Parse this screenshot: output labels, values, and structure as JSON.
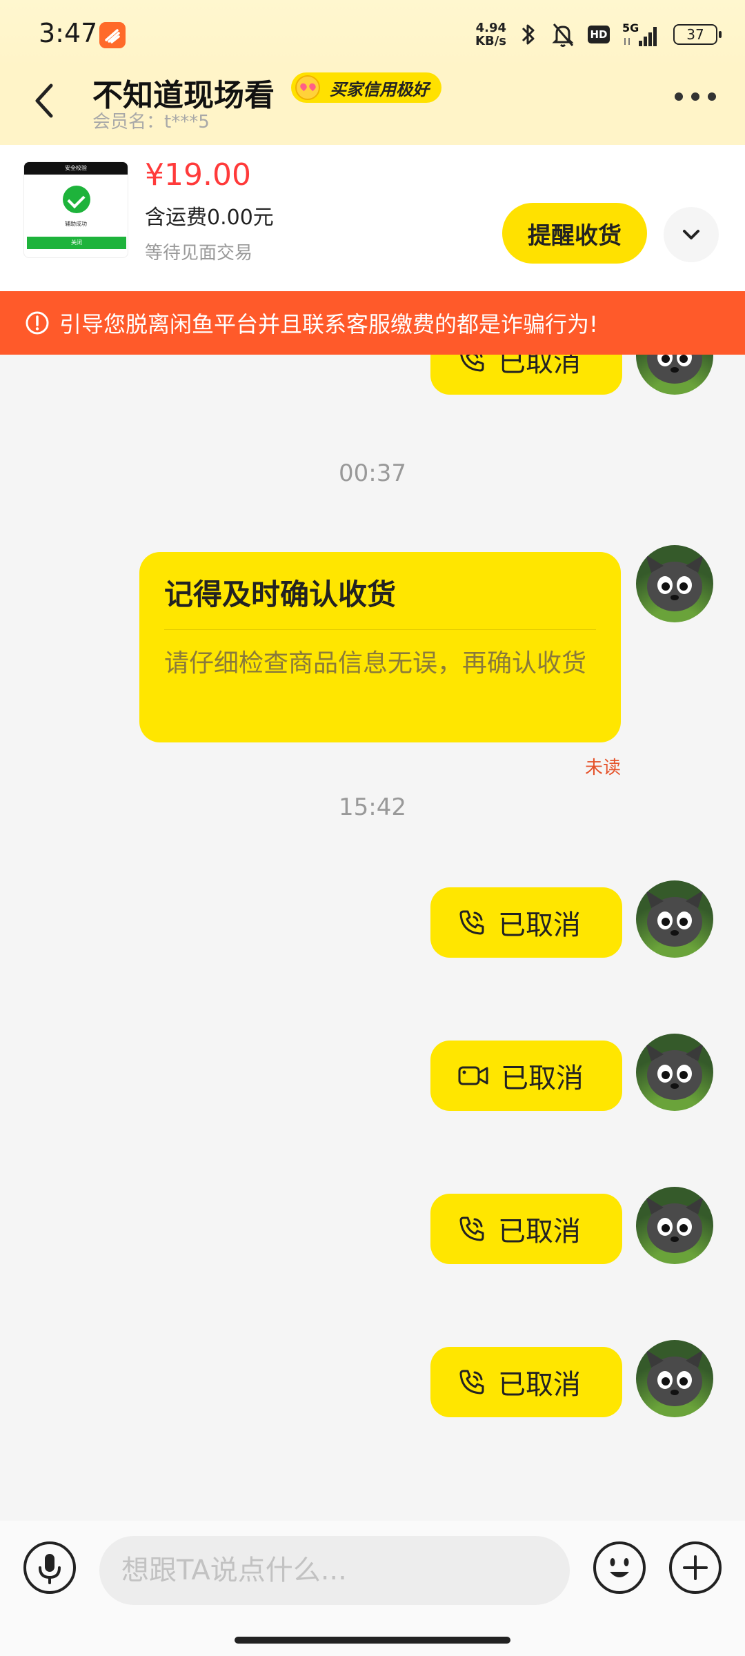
{
  "status_bar": {
    "time": "3:47",
    "net_speed_value": "4.94",
    "net_speed_unit": "KB/s",
    "hd": "HD",
    "signal_label": "5G",
    "battery": "37"
  },
  "header": {
    "title": "不知道现场看",
    "badge": "买家信用极好",
    "member_name": "会员名：t***5"
  },
  "product": {
    "thumb_top": "安全校验",
    "thumb_text": "辅助成功",
    "thumb_button": "关闭",
    "price": "¥19.00",
    "shipping": "含运费0.00元",
    "status": "等待见面交易",
    "remind_label": "提醒收货"
  },
  "warning": {
    "text": "引导您脱离闲鱼平台并且联系客服缴费的都是诈骗行为!"
  },
  "messages": {
    "partial_call_label": "已取消",
    "time_1": "00:37",
    "card_title": "记得及时确认收货",
    "card_body": "请仔细检查商品信息无误，再确认收货",
    "unread": "未读",
    "time_2": "15:42",
    "call_1": "已取消",
    "video_call": "已取消",
    "call_2": "已取消",
    "call_3": "已取消"
  },
  "input": {
    "placeholder": "想跟TA说点什么..."
  },
  "colors": {
    "accent_yellow": "#ffe600",
    "warning_orange": "#ff5a2a",
    "price_red": "#ff3a3a"
  }
}
